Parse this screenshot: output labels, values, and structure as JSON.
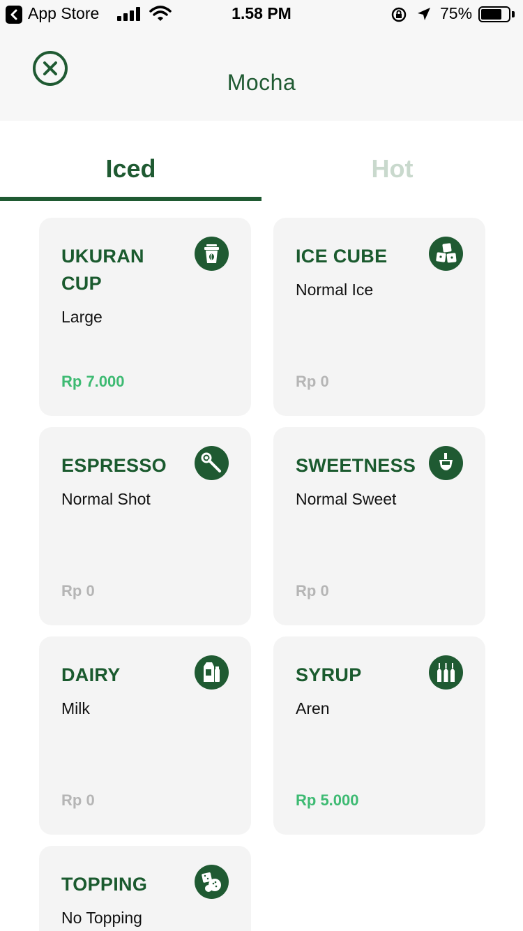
{
  "status_bar": {
    "back_app": "App Store",
    "time": "1.58 PM",
    "battery": "75%",
    "battery_level": 0.75
  },
  "header": {
    "title": "Mocha",
    "close_icon": "close-circle-icon"
  },
  "tabs": [
    {
      "label": "Iced",
      "active": true
    },
    {
      "label": "Hot",
      "active": false
    }
  ],
  "colors": {
    "primary": "#1f5a32",
    "price_positive": "#3dba72",
    "price_zero": "#b5b5b5",
    "tab_inactive": "#c9d9cd",
    "card_bg": "#f4f4f4"
  },
  "options": [
    {
      "title": "UKURAN CUP",
      "value": "Large",
      "price": "Rp 7.000",
      "icon": "cup-icon"
    },
    {
      "title": "ICE CUBE",
      "value": "Normal Ice",
      "price": "Rp 0",
      "icon": "ice-cube-icon"
    },
    {
      "title": "ESPRESSO",
      "value": "Normal Shot",
      "price": "Rp 0",
      "icon": "espresso-icon"
    },
    {
      "title": "SWEETNESS",
      "value": "Normal Sweet",
      "price": "Rp 0",
      "icon": "sweetness-icon"
    },
    {
      "title": "DAIRY",
      "value": "Milk",
      "price": "Rp 0",
      "icon": "dairy-icon"
    },
    {
      "title": "SYRUP",
      "value": "Aren",
      "price": "Rp 5.000",
      "icon": "syrup-icon"
    },
    {
      "title": "TOPPING",
      "value": "No Topping",
      "price": "",
      "icon": "topping-icon"
    }
  ]
}
